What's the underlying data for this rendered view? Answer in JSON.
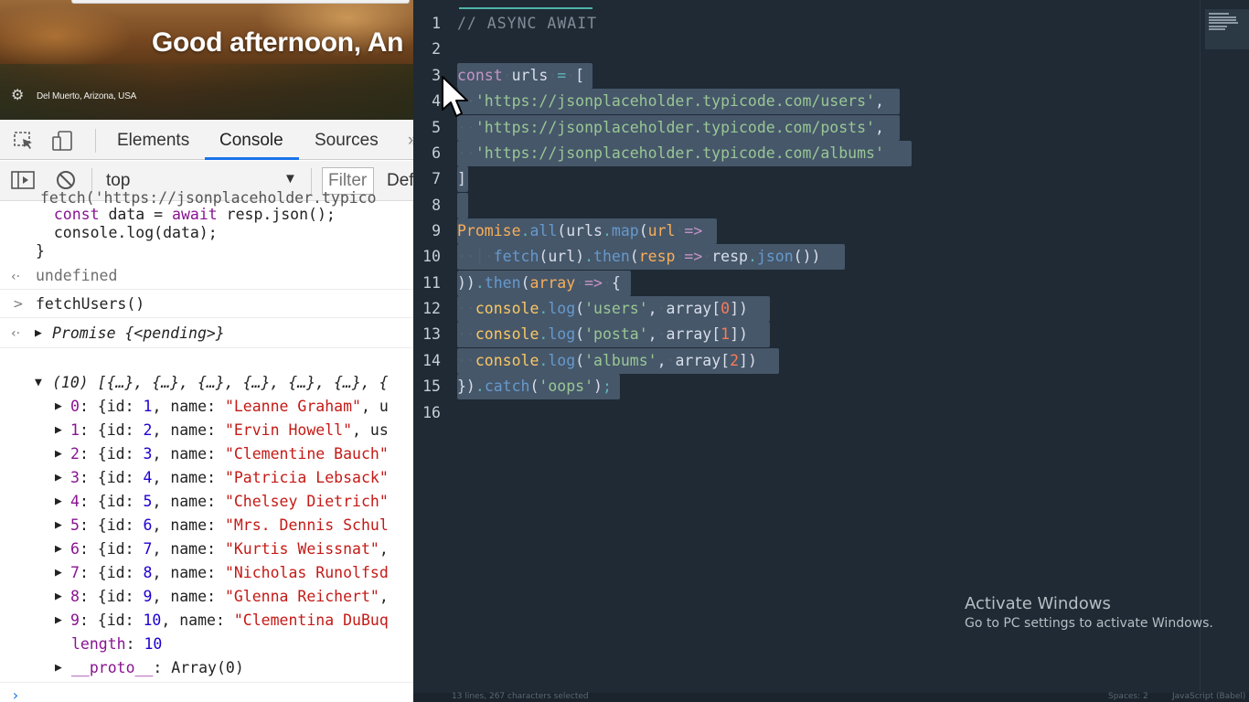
{
  "browser": {
    "greeting": "Good afternoon, An",
    "location": "Del Muerto, Arizona, USA"
  },
  "devtools": {
    "tabs": [
      "Elements",
      "Console",
      "Sources"
    ],
    "active_tab": "Console",
    "context": "top",
    "filter_placeholder": "Filter",
    "levels_label": "Def"
  },
  "console": {
    "partial_first": "fetch('https://jsonplaceholder.typico",
    "code_lines": [
      "  const data = await resp.json();",
      "  console.log(data);",
      "}"
    ],
    "result_undefined": "undefined",
    "input_call": "fetchUsers()",
    "promise_label": "Promise {<pending>}",
    "array_summary": "(10) [{…}, {…}, {…}, {…}, {…}, {…}, {",
    "items": [
      {
        "index": "0",
        "id": "1",
        "name": "\"Leanne Graham\"",
        "tail": ", u"
      },
      {
        "index": "1",
        "id": "2",
        "name": "\"Ervin Howell\"",
        "tail": ", us"
      },
      {
        "index": "2",
        "id": "3",
        "name": "\"Clementine Bauch\"",
        "tail": ""
      },
      {
        "index": "3",
        "id": "4",
        "name": "\"Patricia Lebsack\"",
        "tail": ""
      },
      {
        "index": "4",
        "id": "5",
        "name": "\"Chelsey Dietrich\"",
        "tail": ""
      },
      {
        "index": "5",
        "id": "6",
        "name": "\"Mrs. Dennis Schul",
        "tail": ""
      },
      {
        "index": "6",
        "id": "7",
        "name": "\"Kurtis Weissnat\"",
        "tail": ","
      },
      {
        "index": "7",
        "id": "8",
        "name": "\"Nicholas Runolfsd",
        "tail": ""
      },
      {
        "index": "8",
        "id": "9",
        "name": "\"Glenna Reichert\"",
        "tail": ","
      },
      {
        "index": "9",
        "id": "10",
        "name": "\"Clementina DuBuq",
        "tail": ""
      }
    ],
    "length_key": "length",
    "length_value": "10",
    "proto_key": "__proto__",
    "proto_value": "Array(0)"
  },
  "editor": {
    "line_numbers": [
      "1",
      "2",
      "3",
      "4",
      "5",
      "6",
      "7",
      "8",
      "9",
      "10",
      "11",
      "12",
      "13",
      "14",
      "15",
      "16"
    ],
    "comment": "// ASYNC AWAIT",
    "url1": "'https://jsonplaceholder.typicode.com/users'",
    "url2": "'https://jsonplaceholder.typicode.com/posts'",
    "url3": "'https://jsonplaceholder.typicode.com/albums'",
    "log_users": "'users'",
    "log_posta": "'posta'",
    "log_albums": "'albums'",
    "catch_str": "'oops'",
    "status_left": "13 lines, 267 characters selected",
    "status_spaces": "Spaces: 2",
    "status_syntax": "JavaScript (Babel)"
  },
  "overlay": {
    "activate_title": "Activate Windows",
    "activate_sub": "Go to PC settings to activate Windows."
  },
  "colors": {
    "editor_bg": "#1f2a34",
    "selection": "#46576a",
    "string": "#99c794",
    "keyword": "#c594c5",
    "function": "#6699cc",
    "variable": "#f9ae58",
    "console_active_tab": "#1a73e8"
  }
}
